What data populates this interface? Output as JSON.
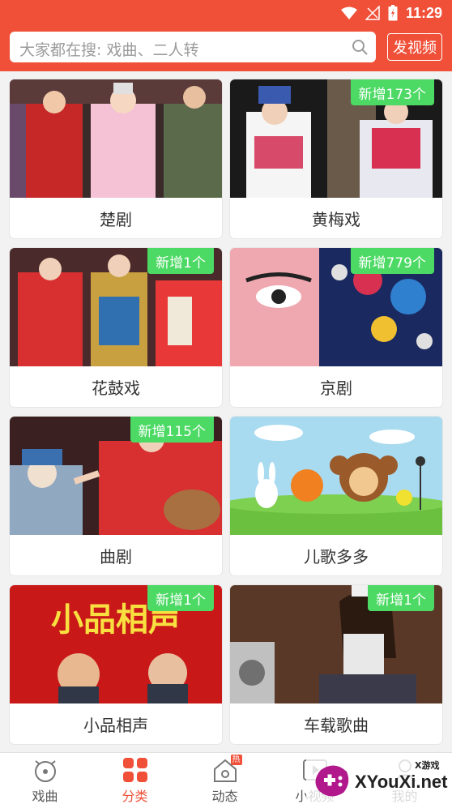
{
  "status_bar": {
    "time": "11:29",
    "icons": [
      "wifi-icon",
      "no-signal-icon",
      "battery-icon"
    ]
  },
  "search": {
    "placeholder": "大家都在搜: 戏曲、二人转",
    "post_video_label": "发视频"
  },
  "categories": [
    {
      "title": "楚剧",
      "badge": ""
    },
    {
      "title": "黄梅戏",
      "badge": "新增173个"
    },
    {
      "title": "花鼓戏",
      "badge": "新增1个"
    },
    {
      "title": "京剧",
      "badge": "新增779个"
    },
    {
      "title": "曲剧",
      "badge": "新增115个"
    },
    {
      "title": "儿歌多多",
      "badge": ""
    },
    {
      "title": "小品相声",
      "badge": "新增1个",
      "image_text": "小品相声"
    },
    {
      "title": "车载歌曲",
      "badge": "新增1个"
    }
  ],
  "nav": {
    "items": [
      {
        "label": "戏曲",
        "icon": "alarm-clock-icon"
      },
      {
        "label": "分类",
        "icon": "grid-icon"
      },
      {
        "label": "动态",
        "icon": "home-icon",
        "badge": "热"
      },
      {
        "label": "小视频",
        "icon": "play-icon"
      },
      {
        "label": "我的",
        "icon": "user-icon"
      }
    ],
    "active_index": 1
  },
  "watermark": {
    "text": "XYouXi.net",
    "sub": "X游戏"
  },
  "colors": {
    "brand": "#f04f38",
    "badge": "#4cd964"
  }
}
